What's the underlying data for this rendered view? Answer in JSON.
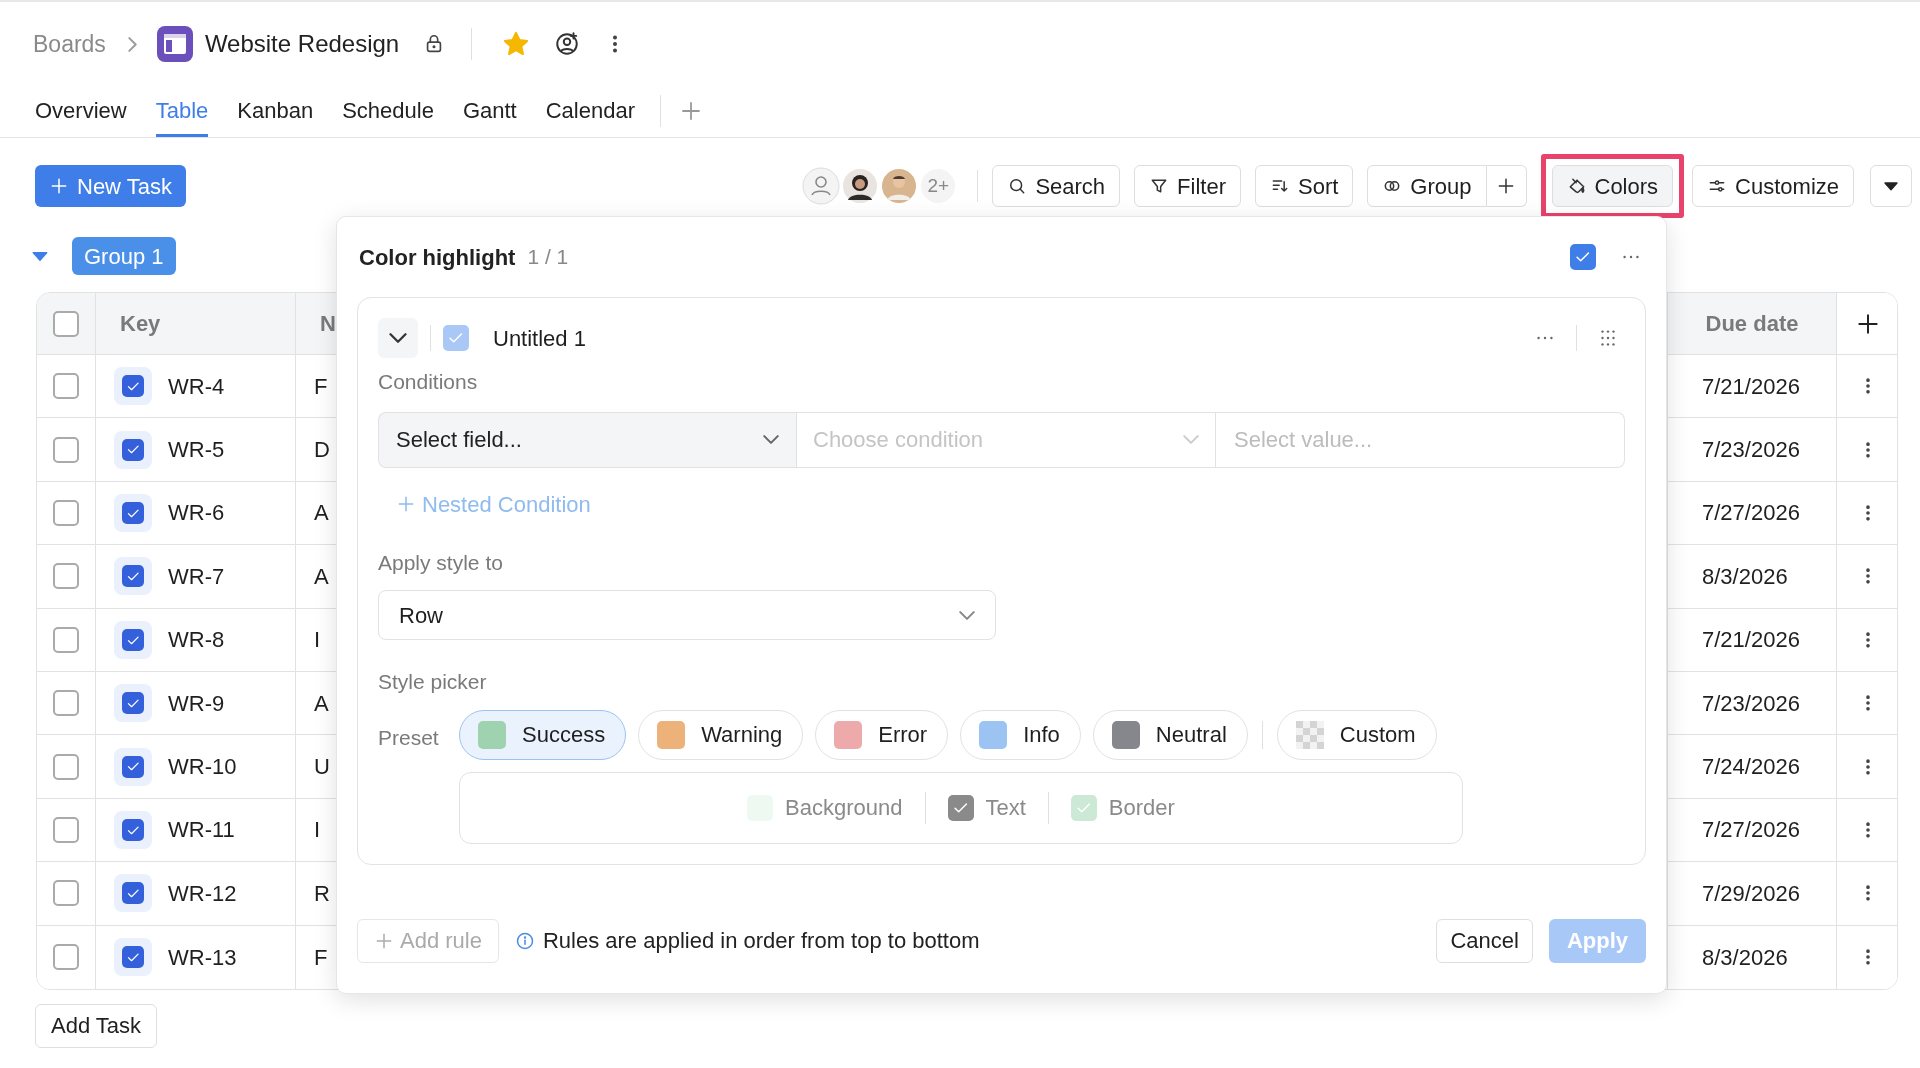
{
  "breadcrumb": {
    "parent": "Boards",
    "board": "Website Redesign",
    "starred": true
  },
  "view_tabs": [
    {
      "label": "Overview",
      "selected": false
    },
    {
      "label": "Table",
      "selected": true
    },
    {
      "label": "Kanban",
      "selected": false
    },
    {
      "label": "Schedule",
      "selected": false
    },
    {
      "label": "Gantt",
      "selected": false
    },
    {
      "label": "Calendar",
      "selected": false
    }
  ],
  "toolbar": {
    "new_task": "New Task",
    "avatars_more": "2+",
    "buttons": [
      {
        "label": "Search",
        "selected": false
      },
      {
        "label": "Filter",
        "selected": false
      },
      {
        "label": "Sort",
        "selected": false
      },
      {
        "label": "Group",
        "selected": false
      },
      {
        "label": "Colors",
        "selected": true
      },
      {
        "label": "Customize",
        "selected": false
      }
    ]
  },
  "group": {
    "label": "Group 1",
    "expanded": true
  },
  "table": {
    "all_selected": false,
    "columns": [
      "Key",
      "N",
      "Due date"
    ],
    "rows": [
      {
        "key": "WR-4",
        "checked": true,
        "name": "F",
        "due": "7/21/2026",
        "selected": false
      },
      {
        "key": "WR-5",
        "checked": true,
        "name": "D",
        "due": "7/23/2026",
        "selected": false
      },
      {
        "key": "WR-6",
        "checked": true,
        "name": "A",
        "due": "7/27/2026",
        "selected": false
      },
      {
        "key": "WR-7",
        "checked": true,
        "name": "A",
        "due": "8/3/2026",
        "selected": false
      },
      {
        "key": "WR-8",
        "checked": true,
        "name": "I",
        "due": "7/21/2026",
        "selected": false
      },
      {
        "key": "WR-9",
        "checked": true,
        "name": "A",
        "due": "7/23/2026",
        "selected": false
      },
      {
        "key": "WR-10",
        "checked": true,
        "name": "U",
        "due": "7/24/2026",
        "selected": false
      },
      {
        "key": "WR-11",
        "checked": true,
        "name": "I",
        "due": "7/27/2026",
        "selected": false
      },
      {
        "key": "WR-12",
        "checked": true,
        "name": "R",
        "due": "7/29/2026",
        "selected": false
      },
      {
        "key": "WR-13",
        "checked": true,
        "name": "F",
        "due": "8/3/2026",
        "selected": false
      }
    ]
  },
  "add_task": "Add Task",
  "color_highlight": {
    "title": "Color highlight",
    "count": "1 / 1",
    "enabled": true,
    "rules": [
      {
        "name": "Untitled 1",
        "enabled": true,
        "expanded": true,
        "conditions_label": "Conditions",
        "field": "Select field...",
        "condition": "Choose condition",
        "condition_disabled": true,
        "value_placeholder": "Select value...",
        "nested": "Nested Condition",
        "apply_label": "Apply style to",
        "apply_to": "Row",
        "style_label": "Style picker",
        "preset_label": "Preset",
        "presets": [
          {
            "label": "Success",
            "kind": "color",
            "color": "#9fd3b0",
            "selected": true
          },
          {
            "label": "Warning",
            "kind": "color",
            "color": "#ecb27a",
            "selected": false
          },
          {
            "label": "Error",
            "kind": "color",
            "color": "#eeaaaa",
            "selected": false
          },
          {
            "label": "Info",
            "kind": "color",
            "color": "#9cc4f2",
            "selected": false
          },
          {
            "label": "Neutral",
            "kind": "color",
            "color": "#86878d",
            "selected": false
          },
          {
            "label": "Custom",
            "kind": "custom",
            "selected": false
          }
        ],
        "targets": [
          {
            "label": "Background",
            "checked": false,
            "color": "#eef9f1"
          },
          {
            "label": "Text",
            "checked": true,
            "color": "#8a8a8a"
          },
          {
            "label": "Border",
            "checked": true,
            "color": "#cbe9d4"
          }
        ]
      }
    ],
    "add_rule": "Add rule",
    "hint": "Rules are applied in order from top to bottom",
    "cancel": "Cancel",
    "apply": "Apply",
    "apply_disabled": true
  }
}
